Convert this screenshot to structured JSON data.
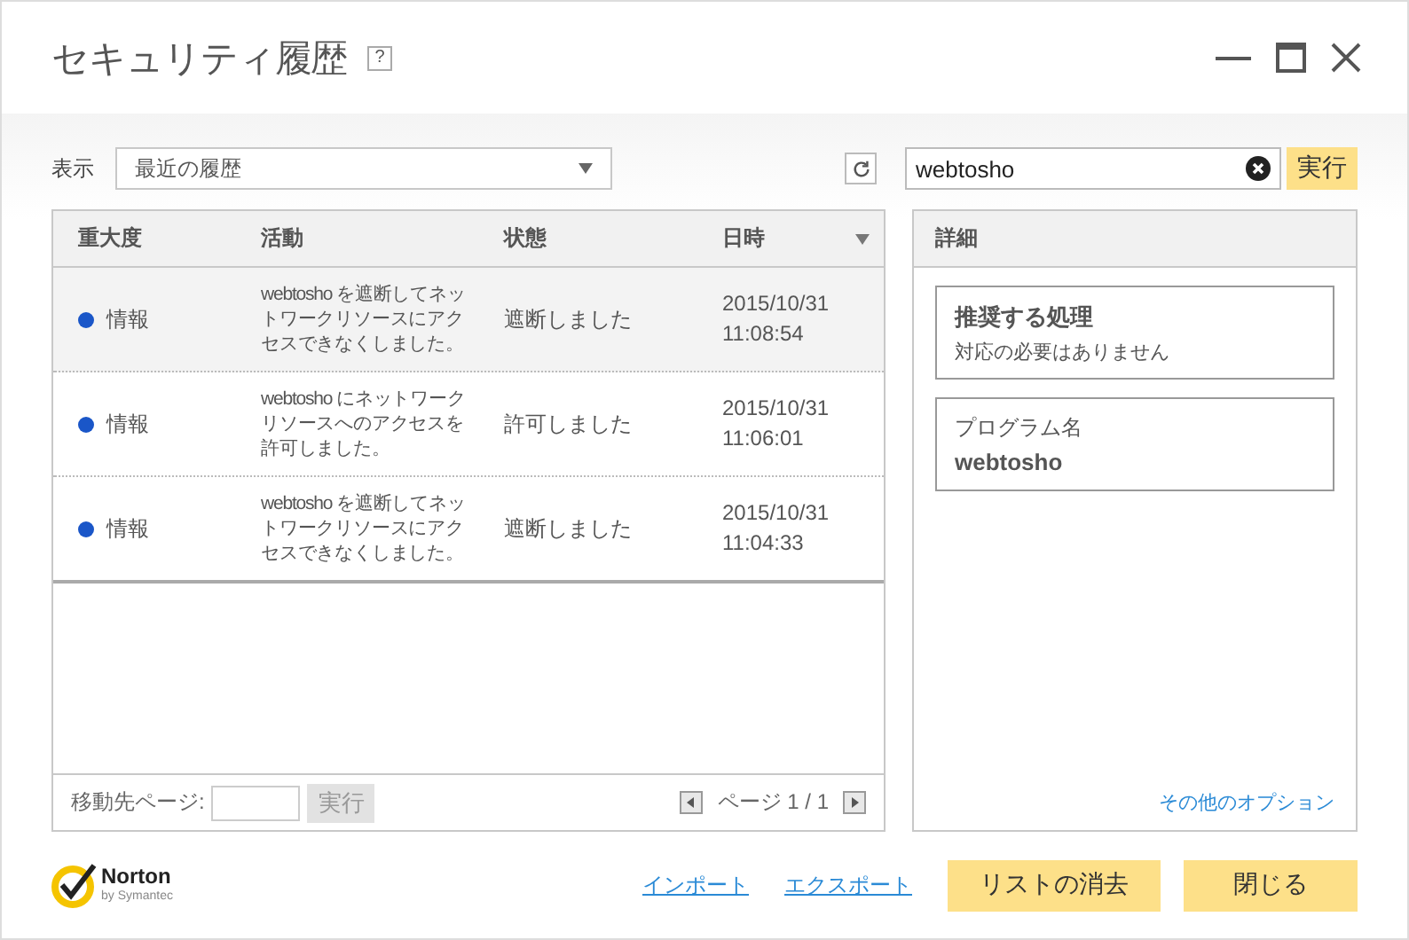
{
  "window": {
    "title": "セキュリティ履歴",
    "help": "?"
  },
  "filter": {
    "label": "表示",
    "value": "最近の履歴"
  },
  "search": {
    "value": "webtosho",
    "button": "実行"
  },
  "table": {
    "columns": [
      {
        "label": "重大度",
        "sorted": false
      },
      {
        "label": "活動",
        "sorted": false
      },
      {
        "label": "状態",
        "sorted": false
      },
      {
        "label": "日時",
        "sorted": true
      }
    ],
    "rows": [
      {
        "severity": "情報",
        "color": "#1a56c8",
        "activity": "webtosho を遮断してネットワークリソースにアクセスできなくしました。",
        "status": "遮断しました",
        "date": "2015/10/31",
        "time": "11:08:54",
        "selected": true
      },
      {
        "severity": "情報",
        "color": "#1a56c8",
        "activity": "webtosho にネットワークリソースへのアクセスを許可しました。",
        "status": "許可しました",
        "date": "2015/10/31",
        "time": "11:06:01",
        "selected": false
      },
      {
        "severity": "情報",
        "color": "#1a56c8",
        "activity": "webtosho を遮断してネットワークリソースにアクセスできなくしました。",
        "status": "遮断しました",
        "date": "2015/10/31",
        "time": "11:04:33",
        "selected": false
      }
    ]
  },
  "pager": {
    "label": "移動先ページ:",
    "button": "実行",
    "disabled": true,
    "page": "ページ 1 / 1"
  },
  "details": {
    "title": "詳細",
    "cards": [
      {
        "kind": "recommendation",
        "heading": "推奨する処理",
        "text": "対応の必要はありません"
      },
      {
        "kind": "program",
        "label": "プログラム名",
        "value": "webtosho"
      }
    ],
    "link": "その他のオプション"
  },
  "footer": {
    "logo": {
      "name": "Norton",
      "tagline": "by Symantec"
    },
    "links": [
      "インポート",
      "エクスポート"
    ],
    "buttons": [
      "リストの消去",
      "閉じる"
    ]
  }
}
